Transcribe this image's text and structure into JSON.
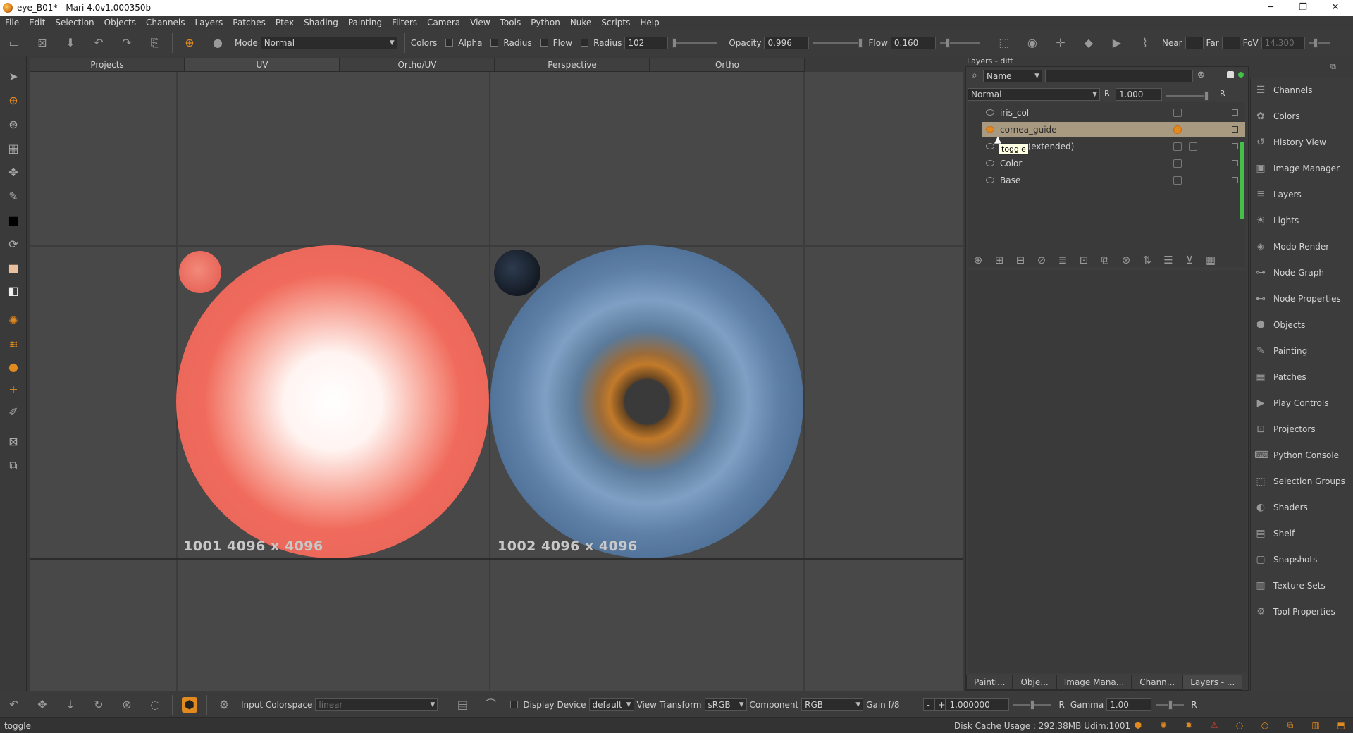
{
  "window": {
    "title": "eye_B01* - Mari 4.0v1.000350b",
    "controls": [
      "─",
      "❐",
      "✕"
    ]
  },
  "menu": [
    "File",
    "Edit",
    "Selection",
    "Objects",
    "Channels",
    "Layers",
    "Patches",
    "Ptex",
    "Shading",
    "Painting",
    "Filters",
    "Camera",
    "View",
    "Tools",
    "Python",
    "Nuke",
    "Scripts",
    "Help"
  ],
  "toolbar": {
    "mode_label": "Mode",
    "mode_value": "Normal",
    "colors_label": "Colors",
    "alpha_label": "Alpha",
    "radius_check_label": "Radius",
    "flow_check_label": "Flow",
    "radius_label": "Radius",
    "radius_value": "102",
    "opacity_label": "Opacity",
    "opacity_value": "0.996",
    "flow_label": "Flow",
    "flow_value": "0.160",
    "near_label": "Near",
    "far_label": "Far",
    "fov_label": "FoV",
    "fov_value": "14.300"
  },
  "viewport_tabs": [
    "Projects",
    "UV",
    "Ortho/UV",
    "Perspective",
    "Ortho"
  ],
  "patches": [
    {
      "label": "1001 4096 x 4096"
    },
    {
      "label": "1002 4096 x 4096"
    }
  ],
  "layers": {
    "header": "Layers - diff",
    "filter_combo": "Name",
    "blend_mode": "Normal",
    "r_label": "R",
    "blend_amount": "1.000",
    "items": [
      {
        "name": "iris_col",
        "selected": false
      },
      {
        "name": "cornea_guide",
        "selected": true
      },
      {
        "name": "nce (extended)",
        "selected": false
      },
      {
        "name": "Color",
        "selected": false
      },
      {
        "name": "Base",
        "selected": false
      }
    ],
    "tooltip": "toggle",
    "bottom_tabs": [
      "Painti...",
      "Obje...",
      "Image Mana...",
      "Chann...",
      "Layers - ..."
    ]
  },
  "right_panel": [
    {
      "label": "Channels",
      "icon": "channels-icon",
      "glyph": "☰"
    },
    {
      "label": "Colors",
      "icon": "colors-icon",
      "glyph": "✿"
    },
    {
      "label": "History View",
      "icon": "history-icon",
      "glyph": "↺"
    },
    {
      "label": "Image Manager",
      "icon": "image-manager-icon",
      "glyph": "▣"
    },
    {
      "label": "Layers",
      "icon": "layers-icon",
      "glyph": "≣"
    },
    {
      "label": "Lights",
      "icon": "lights-icon",
      "glyph": "☀"
    },
    {
      "label": "Modo Render",
      "icon": "modo-render-icon",
      "glyph": "◈"
    },
    {
      "label": "Node Graph",
      "icon": "node-graph-icon",
      "glyph": "⊶"
    },
    {
      "label": "Node Properties",
      "icon": "node-properties-icon",
      "glyph": "⊷"
    },
    {
      "label": "Objects",
      "icon": "objects-icon",
      "glyph": "⬢"
    },
    {
      "label": "Painting",
      "icon": "painting-icon",
      "glyph": "✎"
    },
    {
      "label": "Patches",
      "icon": "patches-icon",
      "glyph": "▦"
    },
    {
      "label": "Play Controls",
      "icon": "play-controls-icon",
      "glyph": "▶"
    },
    {
      "label": "Projectors",
      "icon": "projectors-icon",
      "glyph": "⊡"
    },
    {
      "label": "Python Console",
      "icon": "python-console-icon",
      "glyph": "⌨"
    },
    {
      "label": "Selection Groups",
      "icon": "selection-groups-icon",
      "glyph": "⬚"
    },
    {
      "label": "Shaders",
      "icon": "shaders-icon",
      "glyph": "◐"
    },
    {
      "label": "Shelf",
      "icon": "shelf-icon",
      "glyph": "▤"
    },
    {
      "label": "Snapshots",
      "icon": "snapshots-icon",
      "glyph": "▢"
    },
    {
      "label": "Texture Sets",
      "icon": "texture-sets-icon",
      "glyph": "▥"
    },
    {
      "label": "Tool Properties",
      "icon": "tool-properties-icon",
      "glyph": "⚙"
    }
  ],
  "bottom": {
    "input_colorspace_label": "Input Colorspace",
    "input_colorspace_value": "linear",
    "display_device_label": "Display Device",
    "display_device_value": "default",
    "view_transform_label": "View Transform",
    "view_transform_value": "sRGB",
    "component_label": "Component",
    "component_value": "RGB",
    "gain_label": "Gain f/8",
    "minus": "-",
    "plus": "+",
    "gain_value": "1.000000",
    "r_label": "R",
    "gamma_label": "Gamma",
    "gamma_value": "1.00"
  },
  "status": {
    "left": "toggle",
    "disk_cache": "Disk Cache Usage : 292.38MB",
    "udim": "Udim:1001"
  },
  "colors": {
    "accent": "#e08a20",
    "selected_row": "#a89a80",
    "green": "#44c04a",
    "patch_red": "#f06b5c"
  }
}
